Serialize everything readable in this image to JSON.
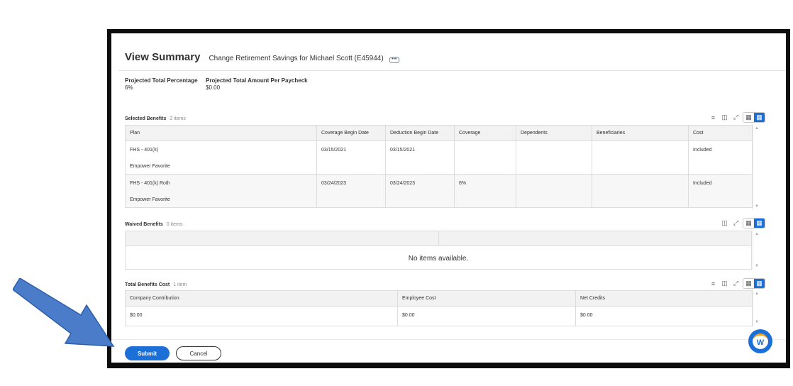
{
  "header": {
    "title": "View Summary",
    "subtitle": "Change Retirement Savings for Michael Scott (E45944)",
    "more_label": "•••"
  },
  "projections": [
    {
      "label": "Projected Total Percentage",
      "value": "6%"
    },
    {
      "label": "Projected Total Amount Per Paycheck",
      "value": "$0.00"
    }
  ],
  "selected_benefits": {
    "title": "Selected Benefits",
    "count": "2 items",
    "columns": [
      "Plan",
      "Coverage Begin Date",
      "Deduction Begin Date",
      "Coverage",
      "Dependents",
      "Beneficiaries",
      "Cost"
    ],
    "rows": [
      {
        "plan": "FHS - 401(k)",
        "provider": "Empower Favorite",
        "coverage_begin": "03/15/2021",
        "deduction_begin": "03/15/2021",
        "coverage": "",
        "dependents": "",
        "beneficiaries": "",
        "cost": "Included"
      },
      {
        "plan": "FHS - 401(k) Roth",
        "provider": "Empower Favorite",
        "coverage_begin": "03/24/2023",
        "deduction_begin": "03/24/2023",
        "coverage": "6%",
        "dependents": "",
        "beneficiaries": "",
        "cost": "Included"
      }
    ]
  },
  "waived_benefits": {
    "title": "Waived Benefits",
    "count": "0 items",
    "empty_message": "No items available."
  },
  "total_cost": {
    "title": "Total Benefits Cost",
    "count": "1 item",
    "columns": [
      "Company Contribution",
      "Employee Cost",
      "Net Credits"
    ],
    "row": {
      "company": "$0.00",
      "employee": "$0.00",
      "net": "$0.00"
    }
  },
  "actions": {
    "submit": "Submit",
    "cancel": "Cancel"
  },
  "help": {
    "label": "W"
  },
  "colors": {
    "accent": "#1d6fd8",
    "arrow": "#4a7cc9"
  },
  "icons": [
    "filter-icon",
    "column-chooser-icon",
    "expand-icon",
    "table-view-icon",
    "grid-view-icon",
    "workday-help-icon",
    "pointer-arrow"
  ]
}
